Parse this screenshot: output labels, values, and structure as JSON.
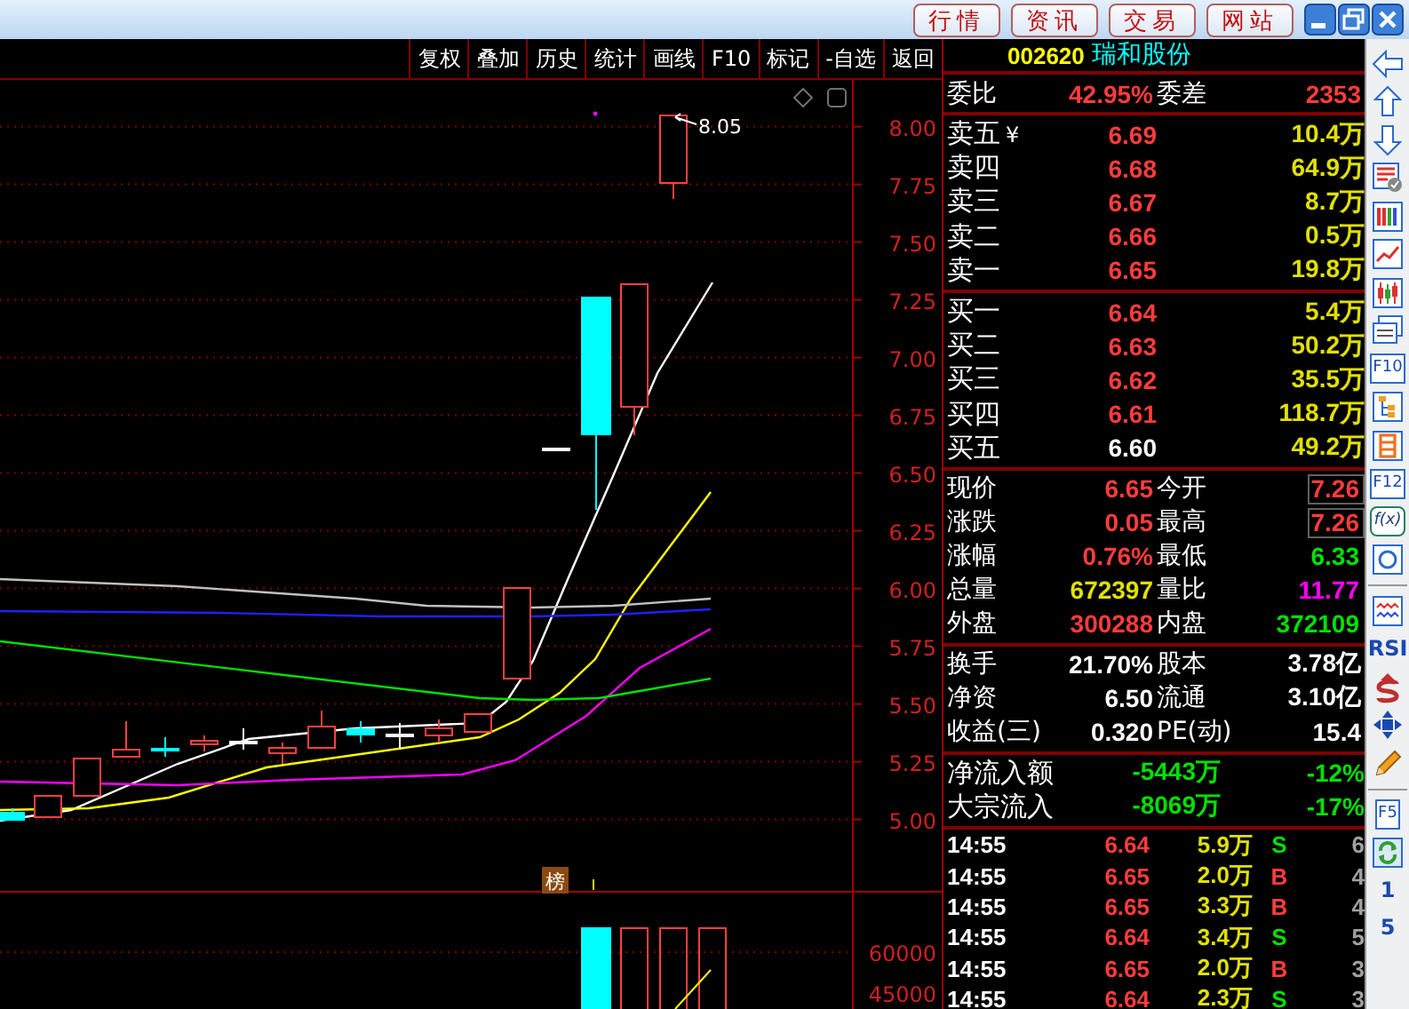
{
  "title_bar": {
    "buttons": [
      "行情",
      "资讯",
      "交易",
      "网站"
    ]
  },
  "toolbar": {
    "items": [
      "复权",
      "叠加",
      "历史",
      "统计",
      "画线",
      "F10",
      "标记",
      "-自选",
      "返回"
    ]
  },
  "chart": {
    "price_axis": [
      "8.00",
      "7.75",
      "7.50",
      "7.25",
      "7.00",
      "6.75",
      "6.50",
      "6.25",
      "6.00",
      "5.75",
      "5.50",
      "5.25",
      "5.00"
    ],
    "volume_axis": [
      "60000",
      "45000"
    ],
    "high_label": "8.05",
    "badge": "榜"
  },
  "stock": {
    "code": "002620",
    "name": "瑞和股份"
  },
  "order_ratio": {
    "label": "委比",
    "value": "42.95%",
    "label2": "委差",
    "value2": "2353"
  },
  "asks": [
    {
      "label": "卖五",
      "note": "¥",
      "price": "6.69",
      "color": "#ff3c3c",
      "volume": "10.4万"
    },
    {
      "label": "卖四",
      "price": "6.68",
      "color": "#ff3c3c",
      "volume": "64.9万"
    },
    {
      "label": "卖三",
      "price": "6.67",
      "color": "#ff3c3c",
      "volume": "8.7万"
    },
    {
      "label": "卖二",
      "price": "6.66",
      "color": "#ff3c3c",
      "volume": "0.5万"
    },
    {
      "label": "卖一",
      "price": "6.65",
      "color": "#ff3c3c",
      "volume": "19.8万"
    }
  ],
  "bids": [
    {
      "label": "买一",
      "price": "6.64",
      "color": "#ff3c3c",
      "volume": "5.4万"
    },
    {
      "label": "买二",
      "price": "6.63",
      "color": "#ff3c3c",
      "volume": "50.2万"
    },
    {
      "label": "买三",
      "price": "6.62",
      "color": "#ff3c3c",
      "volume": "35.5万"
    },
    {
      "label": "买四",
      "price": "6.61",
      "color": "#ff3c3c",
      "volume": "118.7万"
    },
    {
      "label": "买五",
      "price": "6.60",
      "color": "#ffffff",
      "volume": "49.2万"
    }
  ],
  "quotes": [
    {
      "left": {
        "label": "现价",
        "value": "6.65",
        "color": "#ff3c3c"
      },
      "right": {
        "label": "今开",
        "value": "7.26",
        "color": "#ff3c3c",
        "boxed": true
      }
    },
    {
      "left": {
        "label": "涨跌",
        "value": "0.05",
        "color": "#ff3c3c"
      },
      "right": {
        "label": "最高",
        "value": "7.26",
        "color": "#ff3c3c",
        "boxed": true
      }
    },
    {
      "left": {
        "label": "涨幅",
        "value": "0.76%",
        "color": "#ff3c3c"
      },
      "right": {
        "label": "最低",
        "value": "6.33",
        "color": "#00e000",
        "boxed": false
      }
    },
    {
      "left": {
        "label": "总量",
        "value": "672397",
        "color": "#e0e000"
      },
      "right": {
        "label": "量比",
        "value": "11.77",
        "color": "#ff00ff",
        "boxed": false
      }
    },
    {
      "left": {
        "label": "外盘",
        "value": "300288",
        "color": "#ff3c3c"
      },
      "right": {
        "label": "内盘",
        "value": "372109",
        "color": "#00e000",
        "boxed": false
      }
    }
  ],
  "fundamentals": [
    {
      "label": "换手",
      "value": "21.70%",
      "label2": "股本",
      "value2": "3.78亿"
    },
    {
      "label": "净资",
      "value": "6.50",
      "label2": "流通",
      "value2": "3.10亿"
    },
    {
      "label": "收益(三)",
      "value": "0.320",
      "label2": "PE(动)",
      "value2": "15.4"
    }
  ],
  "money_flow": [
    {
      "label": "净流入额",
      "amount": "-5443万",
      "percent": "-12%"
    },
    {
      "label": "大宗流入",
      "amount": "-8069万",
      "percent": "-17%"
    }
  ],
  "trades": [
    {
      "time": "14:55",
      "price": "6.64",
      "volume": "5.9万",
      "side": "S",
      "color": "#00e000",
      "count": "6"
    },
    {
      "time": "14:55",
      "price": "6.65",
      "volume": "2.0万",
      "side": "B",
      "color": "#ff3c3c",
      "count": "4"
    },
    {
      "time": "14:55",
      "price": "6.65",
      "volume": "3.3万",
      "side": "B",
      "color": "#ff3c3c",
      "count": "4"
    },
    {
      "time": "14:55",
      "price": "6.64",
      "volume": "3.4万",
      "side": "S",
      "color": "#00e000",
      "count": "5"
    },
    {
      "time": "14:55",
      "price": "6.65",
      "volume": "2.0万",
      "side": "B",
      "color": "#ff3c3c",
      "count": "3"
    },
    {
      "time": "14:55",
      "price": "6.64",
      "volume": "2.3万",
      "side": "S",
      "color": "#00e000",
      "count": "3"
    }
  ],
  "side_toolbar": {
    "labels": [
      "F10",
      "F12",
      "f(x)",
      "RSI",
      "F5",
      "1",
      "5"
    ]
  }
}
